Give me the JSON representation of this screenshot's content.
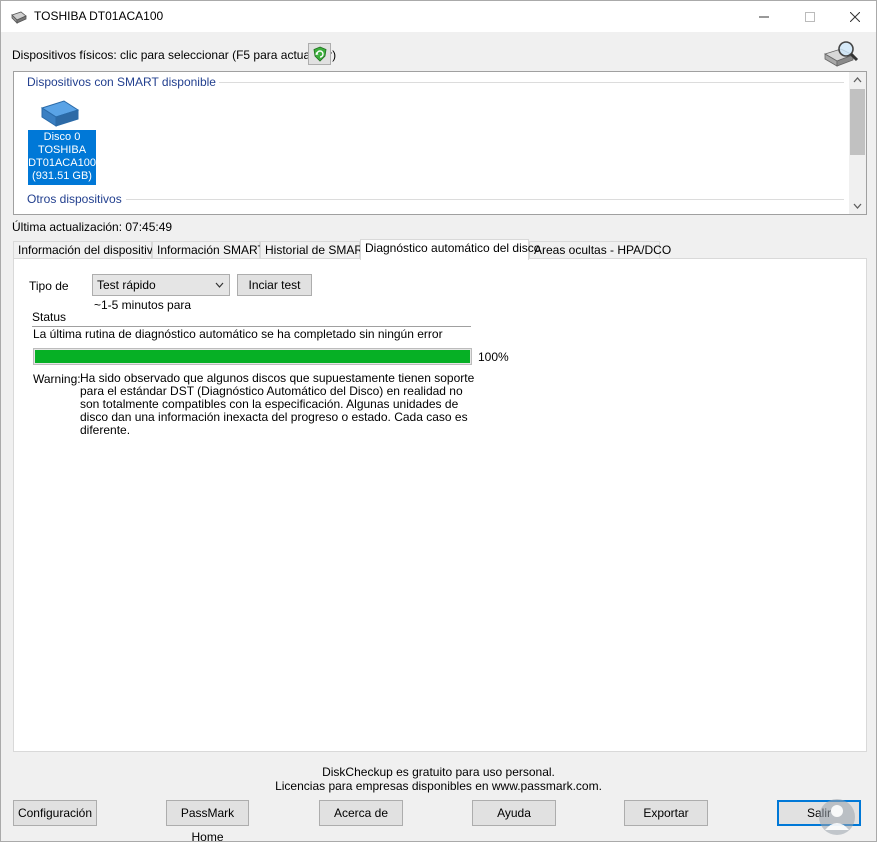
{
  "window": {
    "title": "TOSHIBA DT01ACA100"
  },
  "physical_devices": {
    "label": "Dispositivos físicos: clic para seleccionar (F5 para actualizar)"
  },
  "device_list": {
    "group_smart": "Dispositivos con SMART disponible",
    "group_other": "Otros dispositivos",
    "disk": {
      "line1": "Disco 0",
      "line2": "TOSHIBA",
      "line3": "DT01ACA100",
      "line4": "(931.51 GB)"
    }
  },
  "last_update": "Última actualización: 07:45:49",
  "tabs": [
    {
      "label": "Información del dispositivo"
    },
    {
      "label": "Información SMART"
    },
    {
      "label": "Historial de SMART"
    },
    {
      "label": "Diagnóstico automático del disco"
    },
    {
      "label": "Areas ocultas - HPA/DCO"
    }
  ],
  "diagnostic": {
    "type_label": "Tipo de",
    "type_value": "Test rápido",
    "start_button": "Inciar test",
    "duration": "~1-5 minutos para",
    "status_label": "Status",
    "status_text": "La última rutina de diagnóstico automático se ha completado sin ningún error",
    "progress": 100,
    "progress_label": "100%",
    "warning_label": "Warning:",
    "warning_text": "Ha sido observado que algunos discos que supuestamente tienen soporte para el estándar DST (Diagnóstico Automático del Disco) en realidad no son totalmente compatibles con la especificación. Algunas unidades de disco dan una información inexacta del progreso o estado. Cada caso es diferente."
  },
  "footer": {
    "line1": "DiskCheckup es gratuito para uso personal.",
    "line2": "Licencias para empresas disponibles en www.passmark.com."
  },
  "buttons": {
    "config": "Configuración",
    "home": "PassMark Home",
    "about": "Acerca de",
    "help": "Ayuda",
    "export": "Exportar",
    "exit": "Salir"
  },
  "colors": {
    "selection": "#0078d7",
    "progress": "#06b025",
    "group_header": "#23408f"
  }
}
